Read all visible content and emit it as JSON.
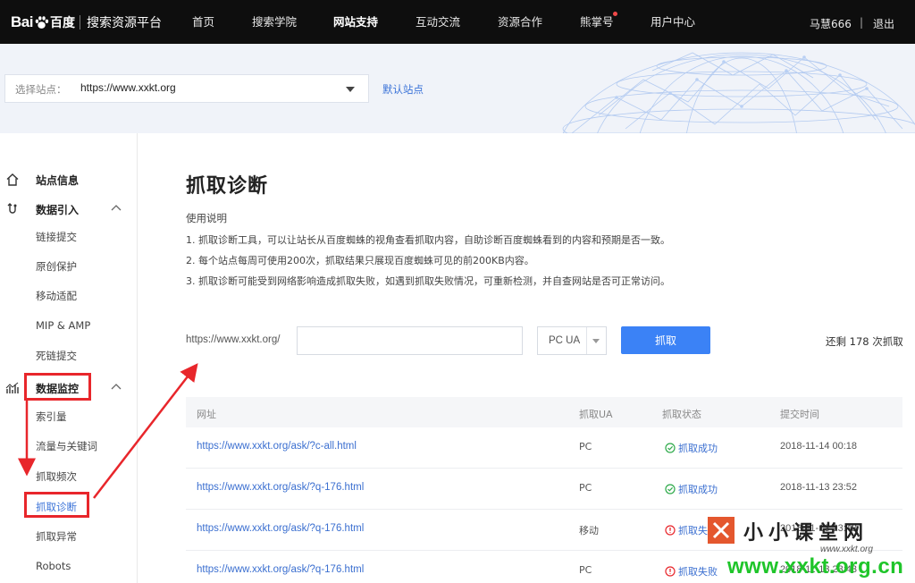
{
  "topnav": {
    "logo_bai": "Bai",
    "logo_du": "百度",
    "logo_title": "搜索资源平台",
    "items": [
      {
        "label": "首页",
        "active": false
      },
      {
        "label": "搜索学院",
        "active": false
      },
      {
        "label": "网站支持",
        "active": true
      },
      {
        "label": "互动交流",
        "active": false
      },
      {
        "label": "资源合作",
        "active": false
      },
      {
        "label": "熊掌号",
        "active": false
      },
      {
        "label": "用户中心",
        "active": false
      }
    ],
    "user_name": "马慧666",
    "separator": "|",
    "logout": "退出"
  },
  "banner": {
    "select_label": "选择站点：",
    "select_value": "https://www.xxkt.org",
    "default_site": "默认站点"
  },
  "sidebar": {
    "groups": [
      {
        "label": "站点信息",
        "icon": "home-icon"
      },
      {
        "label": "数据引入",
        "icon": "data-import-icon"
      },
      {
        "label": "数据监控",
        "icon": "chart-icon"
      }
    ],
    "import_items": [
      "链接提交",
      "原创保护",
      "移动适配",
      "MIP & AMP",
      "死链提交"
    ],
    "monitor_items": [
      "索引量",
      "流量与关键词",
      "抓取频次",
      "抓取诊断",
      "抓取异常",
      "Robots"
    ]
  },
  "main": {
    "title": "抓取诊断",
    "usage_title": "使用说明",
    "usage_lines": [
      "1. 抓取诊断工具，可以让站长从百度蜘蛛的视角查看抓取内容，自助诊断百度蜘蛛看到的内容和预期是否一致。",
      "2. 每个站点每周可使用200次，抓取结果只展现百度蜘蛛可见的前200KB内容。",
      "3. 抓取诊断可能受到网络影响造成抓取失败，如遇到抓取失败情况，可重新检测，并自查网站是否可正常访问。"
    ],
    "url_prefix": "https://www.xxkt.org/",
    "url_input_value": "",
    "ua_value": "PC UA",
    "fetch_button": "抓取",
    "remaining": "还剩 178 次抓取"
  },
  "table": {
    "headers": [
      "网址",
      "抓取UA",
      "抓取状态",
      "提交时间"
    ],
    "rows": [
      {
        "url": "https://www.xxkt.org/ask/?c-all.html",
        "ua": "PC",
        "status": "抓取成功",
        "status_type": "success",
        "time": "2018-11-14 00:18"
      },
      {
        "url": "https://www.xxkt.org/ask/?q-176.html",
        "ua": "PC",
        "status": "抓取成功",
        "status_type": "success",
        "time": "2018-11-13 23:52"
      },
      {
        "url": "https://www.xxkt.org/ask/?q-176.html",
        "ua": "移动",
        "status": "抓取失败",
        "status_type": "fail",
        "time": "2018-11-13 23:43"
      },
      {
        "url": "https://www.xxkt.org/ask/?q-176.html",
        "ua": "PC",
        "status": "抓取失败",
        "status_type": "fail",
        "time": "2018-11-13 23:43"
      }
    ]
  },
  "watermark": {
    "title": "小小课堂网",
    "sub": "www.xxkt.org",
    "url": "www.xxkt.org.cn"
  },
  "colors": {
    "accent": "#3b82f6",
    "link": "#3b6fd0",
    "success": "#2eaa4a",
    "fail": "#e8262b",
    "annotation": "#e8262b",
    "watermark_green": "#1fc52a"
  }
}
